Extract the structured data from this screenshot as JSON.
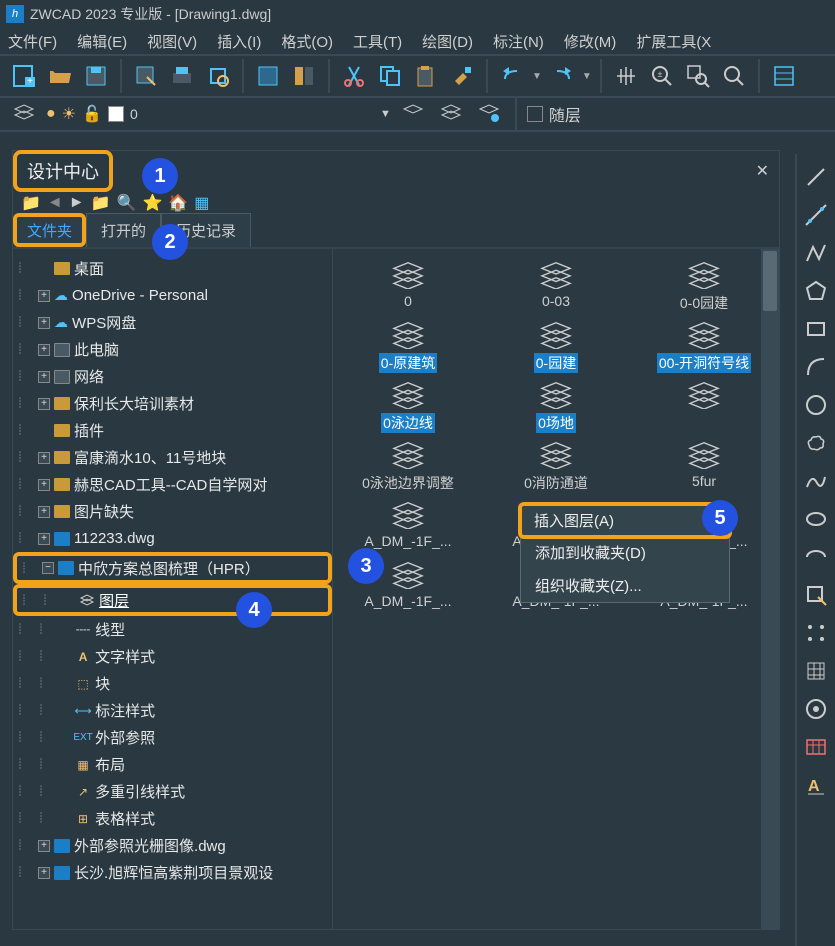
{
  "title": "ZWCAD 2023 专业版 - [Drawing1.dwg]",
  "menus": [
    "文件(F)",
    "编辑(E)",
    "视图(V)",
    "插入(I)",
    "格式(O)",
    "工具(T)",
    "绘图(D)",
    "标注(N)",
    "修改(M)",
    "扩展工具(X"
  ],
  "layer_current": "0",
  "layer_bylayer": "随层",
  "dc": {
    "title": "设计中心",
    "tabs": [
      "文件夹",
      "打开的",
      "历史记录"
    ],
    "tree": [
      {
        "ind": 1,
        "exp": false,
        "icon": "folder",
        "label": "桌面",
        "hl": false
      },
      {
        "ind": 1,
        "exp": true,
        "icon": "cloud",
        "label": "OneDrive - Personal"
      },
      {
        "ind": 1,
        "exp": true,
        "icon": "cloud",
        "label": "WPS网盘"
      },
      {
        "ind": 1,
        "exp": true,
        "icon": "drive",
        "label": "此电脑"
      },
      {
        "ind": 1,
        "exp": true,
        "icon": "drive",
        "label": "网络"
      },
      {
        "ind": 1,
        "exp": true,
        "icon": "folder",
        "label": "保利长大培训素材"
      },
      {
        "ind": 1,
        "exp": null,
        "icon": "folder",
        "label": "插件"
      },
      {
        "ind": 1,
        "exp": true,
        "icon": "folder",
        "label": "富康滴水10、11号地块"
      },
      {
        "ind": 1,
        "exp": true,
        "icon": "folder",
        "label": "赫思CAD工具--CAD自学网对"
      },
      {
        "ind": 1,
        "exp": true,
        "icon": "folder",
        "label": "图片缺失"
      },
      {
        "ind": 1,
        "exp": true,
        "icon": "dwg",
        "label": "112233.dwg"
      },
      {
        "ind": 1,
        "exp": "minus",
        "icon": "dwg",
        "label": "中欣方案总图梳理（HPR）",
        "hl": true
      },
      {
        "ind": 2,
        "exp": null,
        "icon": "layers",
        "label": "图层",
        "hl": true,
        "sel": true
      },
      {
        "ind": 2,
        "exp": null,
        "icon": "line",
        "label": "线型"
      },
      {
        "ind": 2,
        "exp": null,
        "icon": "text",
        "label": "文字样式"
      },
      {
        "ind": 2,
        "exp": null,
        "icon": "block",
        "label": "块"
      },
      {
        "ind": 2,
        "exp": null,
        "icon": "dim",
        "label": "标注样式"
      },
      {
        "ind": 2,
        "exp": null,
        "icon": "xref",
        "label": "外部参照"
      },
      {
        "ind": 2,
        "exp": null,
        "icon": "layout",
        "label": "布局"
      },
      {
        "ind": 2,
        "exp": null,
        "icon": "mleader",
        "label": "多重引线样式"
      },
      {
        "ind": 2,
        "exp": null,
        "icon": "table",
        "label": "表格样式"
      },
      {
        "ind": 1,
        "exp": true,
        "icon": "dwg",
        "label": "外部参照光栅图像.dwg"
      },
      {
        "ind": 1,
        "exp": true,
        "icon": "dwg",
        "label": "长沙.旭辉恒高紫荆项目景观设"
      }
    ],
    "grid": [
      {
        "label": "0"
      },
      {
        "label": "0-03"
      },
      {
        "label": "0-0园建"
      },
      {
        "label": "0-原建筑",
        "sel": true
      },
      {
        "label": "0-园建",
        "sel": true
      },
      {
        "label": "00-开洞符号线",
        "sel": true
      },
      {
        "label": "0泳边线",
        "sel": true,
        "clipped": true
      },
      {
        "label": "0场地",
        "sel": true,
        "clipped": true
      },
      {
        "label": ""
      },
      {
        "label": "0泳池边界调整"
      },
      {
        "label": "0消防通道"
      },
      {
        "label": "5fur"
      },
      {
        "label": "A_DM_-1F_..."
      },
      {
        "label": "A_DM_-1F_..."
      },
      {
        "label": "A_DM_-1F_..."
      },
      {
        "label": "A_DM_-1F_..."
      },
      {
        "label": "A_DM_-1F_..."
      },
      {
        "label": "A_DM_-1F_..."
      }
    ],
    "ctx": [
      "插入图层(A)",
      "添加到收藏夹(D)",
      "组织收藏夹(Z)..."
    ]
  },
  "steps": [
    "1",
    "2",
    "3",
    "4",
    "5"
  ]
}
